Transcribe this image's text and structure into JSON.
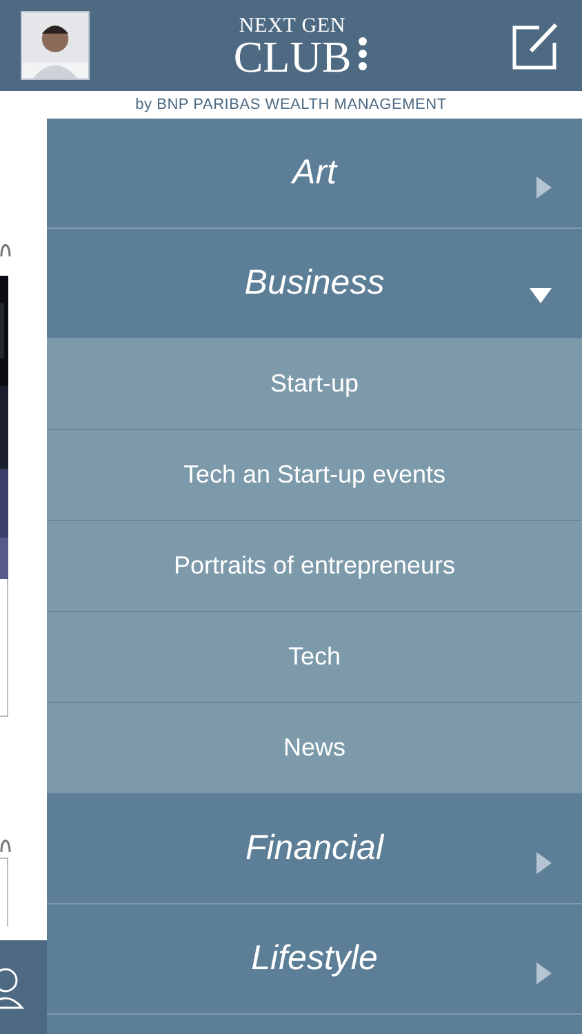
{
  "header": {
    "title_top": "NEXT GEN",
    "title_main": "CLUB",
    "subtitle": "by BNP PARIBAS WEALTH MANAGEMENT"
  },
  "menu": [
    {
      "label": "Art",
      "expanded": false
    },
    {
      "label": "Business",
      "expanded": true,
      "children": [
        {
          "label": "Start-up"
        },
        {
          "label": "Tech an Start-up events"
        },
        {
          "label": "Portraits of entrepreneurs"
        },
        {
          "label": "Tech"
        },
        {
          "label": "News"
        }
      ]
    },
    {
      "label": "Financial",
      "expanded": false
    },
    {
      "label": "Lifestyle",
      "expanded": false
    }
  ]
}
